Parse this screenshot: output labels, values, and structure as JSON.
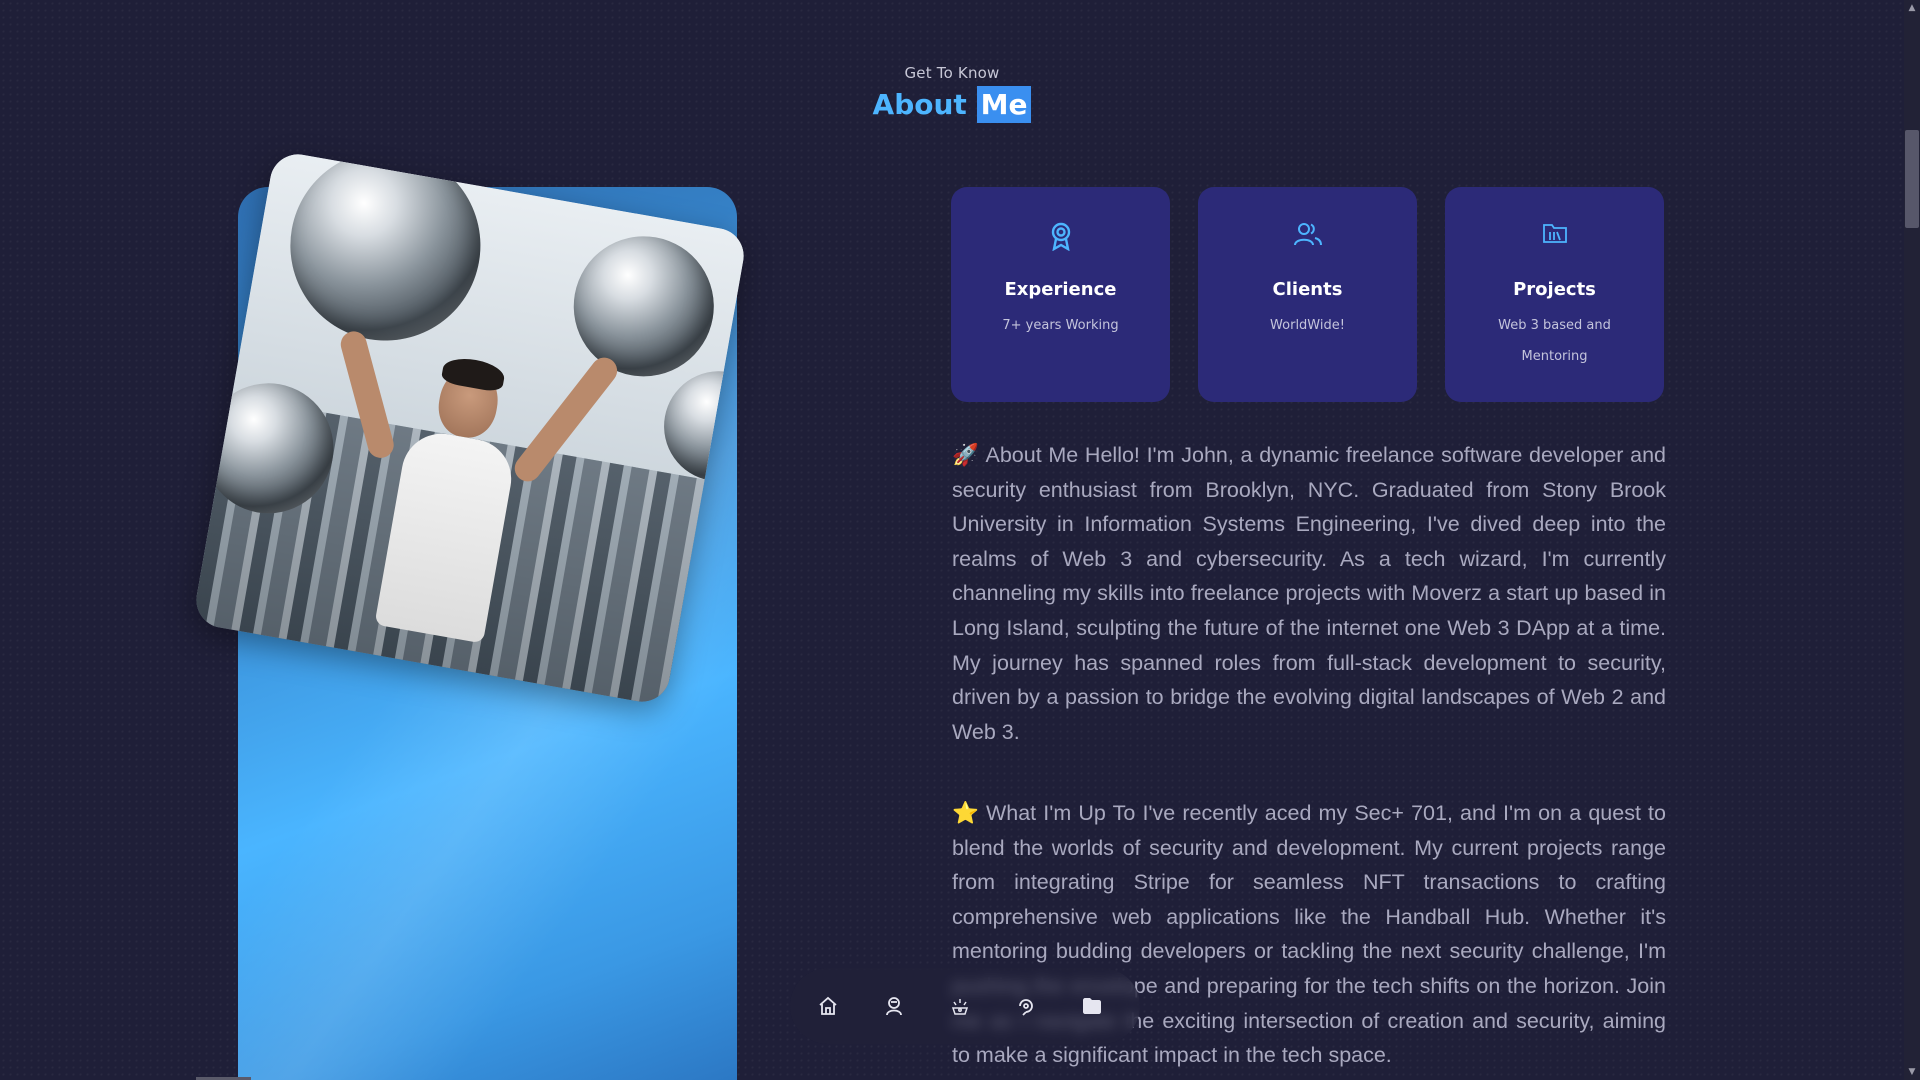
{
  "header": {
    "eyebrow": "Get To Know",
    "title_main": "About",
    "title_highlight": "Me"
  },
  "colors": {
    "background": "#1f1f38",
    "accent": "#4db5ff",
    "card": "#2c2a78"
  },
  "cards": [
    {
      "icon": "award-icon",
      "title": "Experience",
      "subtitle": "7+ years Working"
    },
    {
      "icon": "users-icon",
      "title": "Clients",
      "subtitle": "WorldWide!"
    },
    {
      "icon": "folder-library-icon",
      "title": "Projects",
      "subtitle": "Web 3 based and Mentoring"
    }
  ],
  "paragraphs": [
    {
      "emoji": "🚀",
      "text": "About Me Hello! I'm John, a dynamic freelance software developer and security enthusiast from Brooklyn, NYC. Graduated from Stony Brook University in Information Systems Engineering, I've dived deep into the realms of Web 3 and cybersecurity. As a tech wizard, I'm currently channeling my skills into freelance projects with Moverz a start up based in Long Island, sculpting the future of the internet one Web 3 DApp at a time. My journey has spanned roles from full-stack development to security, driven by a passion to bridge the evolving digital landscapes of Web 2 and Web 3."
    },
    {
      "emoji": "⭐",
      "text": "What I'm Up To I've recently aced my Sec+ 701, and I'm on a quest to blend the worlds of security and development. My current projects range from integrating Stripe for seamless NFT transactions to crafting comprehensive web applications like the Handball Hub. Whether it's mentoring budding developers or tackling the next security challenge, I'm pushing the envelope and preparing for the tech shifts on the horizon. Join me as I navigate the exciting intersection of creation and security, aiming to make a significant impact in the tech space."
    }
  ],
  "nav": [
    {
      "icon": "home-icon"
    },
    {
      "icon": "user-icon"
    },
    {
      "icon": "skills-icon"
    },
    {
      "icon": "services-icon"
    },
    {
      "icon": "folder-icon"
    }
  ]
}
